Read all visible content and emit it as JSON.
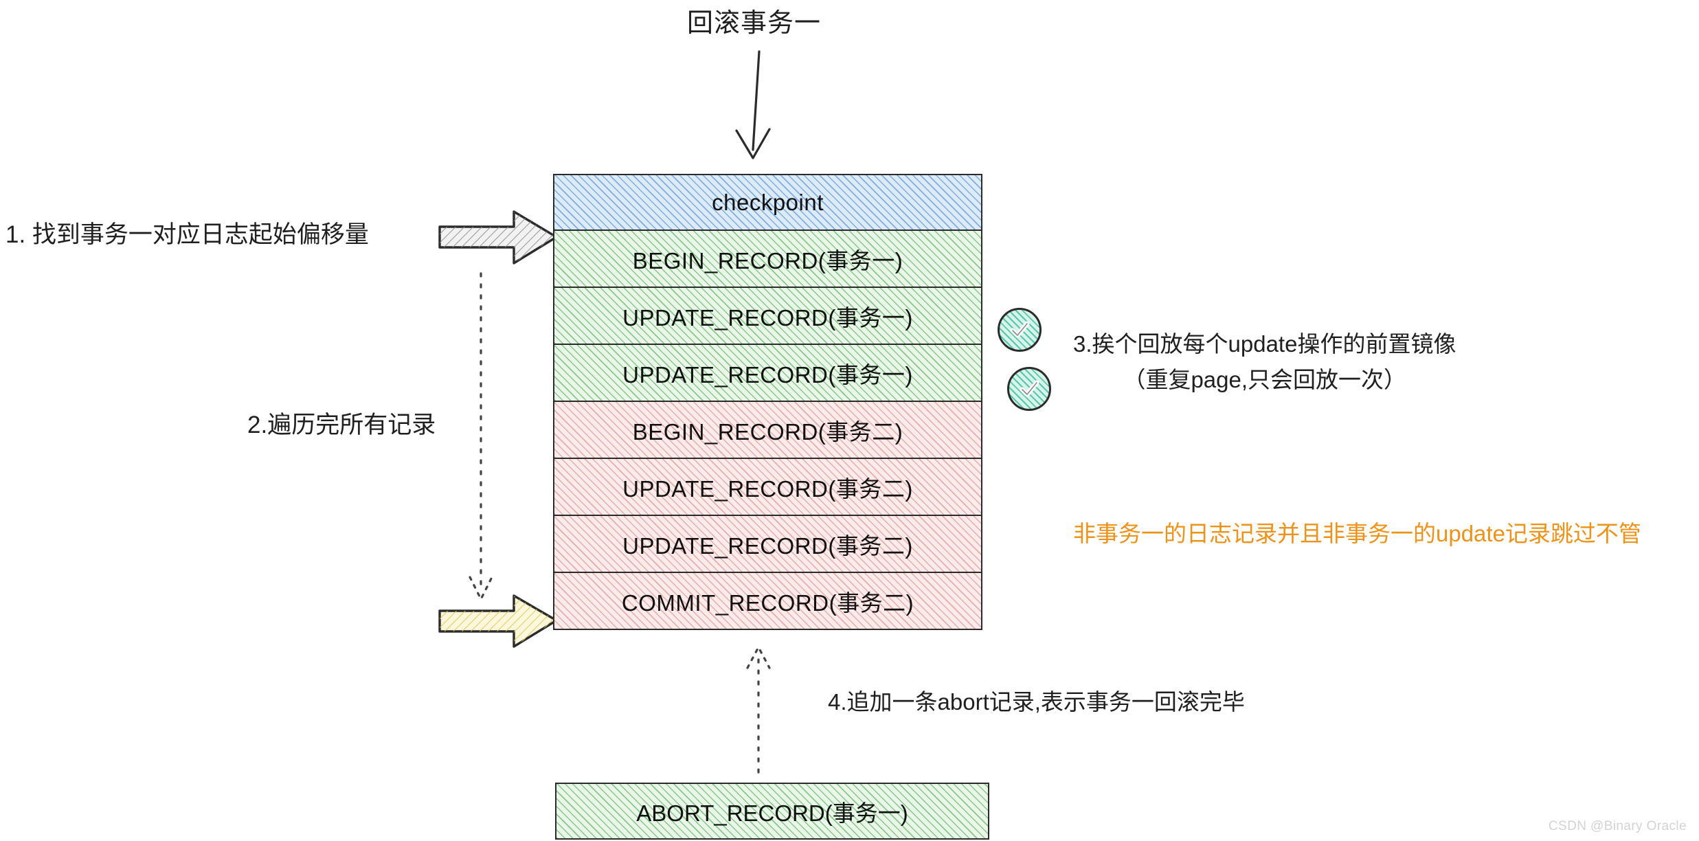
{
  "title": "回滚事务一",
  "log_table": {
    "rows": [
      {
        "label": "checkpoint",
        "fill": "blue",
        "name": "log-row-checkpoint"
      },
      {
        "label": "BEGIN_RECORD(事务一)",
        "fill": "green",
        "name": "log-row-begin-tx1"
      },
      {
        "label": "UPDATE_RECORD(事务一)",
        "fill": "green",
        "name": "log-row-update-tx1-a"
      },
      {
        "label": "UPDATE_RECORD(事务一)",
        "fill": "green",
        "name": "log-row-update-tx1-b"
      },
      {
        "label": "BEGIN_RECORD(事务二)",
        "fill": "pink",
        "name": "log-row-begin-tx2"
      },
      {
        "label": "UPDATE_RECORD(事务二)",
        "fill": "pink",
        "name": "log-row-update-tx2-a"
      },
      {
        "label": "UPDATE_RECORD(事务二)",
        "fill": "pink",
        "name": "log-row-update-tx2-b"
      },
      {
        "label": "COMMIT_RECORD(事务二)",
        "fill": "pink",
        "name": "log-row-commit-tx2"
      }
    ]
  },
  "abort_box": {
    "label": "ABORT_RECORD(事务一)",
    "fill": "green"
  },
  "notes": {
    "step1": "1. 找到事务一对应日志起始偏移量",
    "step2": "2.遍历完所有记录",
    "step3_line1": "3.挨个回放每个update操作的前置镜像",
    "step3_line2": "（重复page,只会回放一次）",
    "step4": "4.追加一条abort记录,表示事务一回滚完毕",
    "skip": "非事务一的日志记录并且非事务一的update记录跳过不管"
  },
  "icons": {
    "check_badge_1": "check-circle-icon",
    "check_badge_2": "check-circle-icon",
    "grey_arrow": "arrow-right-icon",
    "yellow_arrow": "arrow-right-icon",
    "top_arrow": "arrow-down-icon",
    "traverse_arrow": "dotted-arrow-down-icon",
    "append_arrow": "dotted-arrow-up-icon"
  },
  "colors": {
    "checkpoint_fill": "#ddeaf7",
    "tx1_fill": "#e9f6e9",
    "tx2_fill": "#fbeceb",
    "skip_text": "#ef9218",
    "stroke": "#2b2b2b",
    "grey_arrow_fill": "#f2f2f2",
    "yellow_arrow_fill": "#fdf8dd",
    "check_badge_fill": "#d9f2ea",
    "watermark": "#d3d3d3"
  },
  "watermark": "CSDN @Binary Oracle"
}
